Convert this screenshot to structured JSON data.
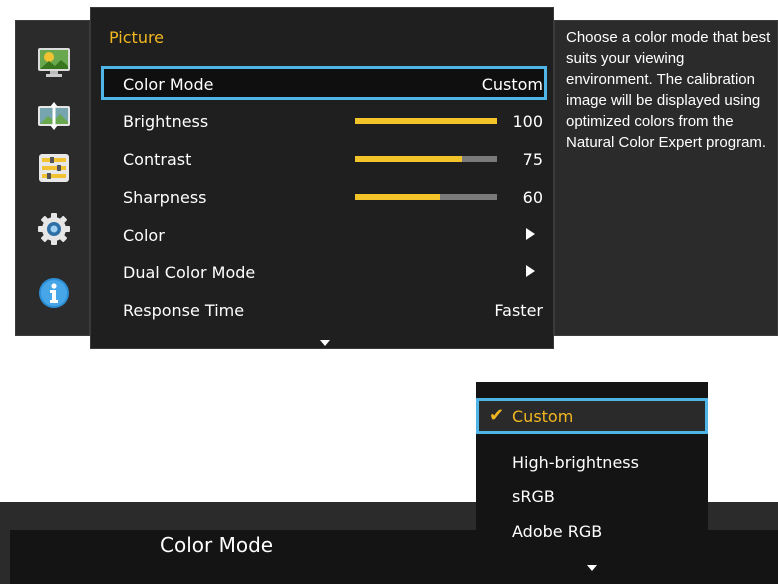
{
  "sidebar": {
    "icons": [
      {
        "name": "picture-icon"
      },
      {
        "name": "screen-size-icon"
      },
      {
        "name": "onscreen-display-icon"
      },
      {
        "name": "system-gear-icon"
      },
      {
        "name": "information-icon"
      }
    ]
  },
  "menu": {
    "title": "Picture",
    "items": [
      {
        "label": "Color Mode",
        "value": "Custom"
      },
      {
        "label": "Brightness",
        "value": "100",
        "level": 100
      },
      {
        "label": "Contrast",
        "value": "75",
        "level": 75
      },
      {
        "label": "Sharpness",
        "value": "60",
        "level": 60
      },
      {
        "label": "Color",
        "value": ""
      },
      {
        "label": "Dual Color Mode",
        "value": ""
      },
      {
        "label": "Response Time",
        "value": "Faster"
      }
    ]
  },
  "help": {
    "text": "Choose a color mode that best suits your viewing environment. The calibration image will be displayed using optimized colors from the Natural Color Expert program."
  },
  "bottom": {
    "title": "Color Mode"
  },
  "dropdown": {
    "options": [
      {
        "label": "Custom",
        "selected": true
      },
      {
        "label": "High-brightness",
        "selected": false
      },
      {
        "label": "sRGB",
        "selected": false
      },
      {
        "label": "Adobe RGB",
        "selected": false
      }
    ]
  },
  "colors": {
    "accent": "#f3b820",
    "focus": "#4fb4e6",
    "bar_fill": "#f3c42a",
    "bar_track": "#7a7a7a"
  }
}
